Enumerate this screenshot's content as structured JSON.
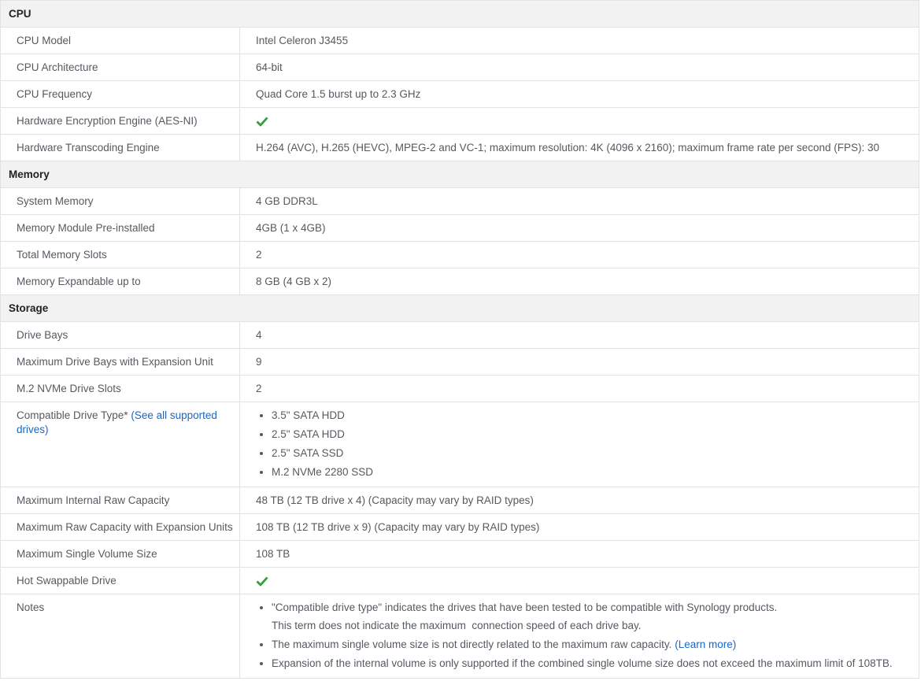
{
  "sections": {
    "cpu": {
      "title": "CPU",
      "rows": [
        {
          "label": "CPU Model",
          "value": "Intel Celeron J3455"
        },
        {
          "label": "CPU Architecture",
          "value": "64-bit"
        },
        {
          "label": "CPU Frequency",
          "value": "Quad Core 1.5 burst up to 2.3 GHz"
        },
        {
          "label": "Hardware Encryption Engine (AES-NI)",
          "icon": "check-icon"
        },
        {
          "label": "Hardware Transcoding Engine",
          "value": "H.264 (AVC), H.265 (HEVC), MPEG-2 and VC-1; maximum resolution: 4K (4096 x 2160); maximum frame rate per second (FPS): 30"
        }
      ]
    },
    "memory": {
      "title": "Memory",
      "rows": [
        {
          "label": "System Memory",
          "value": "4 GB DDR3L"
        },
        {
          "label": "Memory Module Pre-installed",
          "value": "4GB (1 x 4GB)"
        },
        {
          "label": "Total Memory Slots",
          "value": "2"
        },
        {
          "label": "Memory Expandable up to",
          "value": "8 GB (4 GB x 2)"
        }
      ]
    },
    "storage": {
      "title": "Storage",
      "rows": [
        {
          "label": "Drive Bays",
          "value": "4"
        },
        {
          "label": "Maximum Drive Bays with Expansion Unit",
          "value": "9"
        },
        {
          "label": "M.2 NVMe Drive Slots",
          "value": "2"
        },
        {
          "label": "Compatible Drive Type*",
          "link": "(See all supported drives)",
          "items": [
            "3.5\" SATA HDD",
            "2.5\" SATA HDD",
            "2.5\" SATA SSD",
            "M.2 NVMe 2280 SSD"
          ]
        },
        {
          "label": "Maximum Internal Raw Capacity",
          "value": "48 TB (12 TB drive x 4) (Capacity may vary by RAID types)"
        },
        {
          "label": "Maximum Raw Capacity with Expansion Units",
          "value": "108 TB (12 TB drive x 9) (Capacity may vary by RAID types)"
        },
        {
          "label": "Maximum Single Volume Size",
          "value": "108 TB"
        },
        {
          "label": "Hot Swappable Drive",
          "icon": "check-icon"
        },
        {
          "label": "Notes",
          "notes": [
            {
              "line1": "\"Compatible drive type\" indicates the drives that have been tested to be compatible with Synology products.",
              "line2": "This term does not indicate the maximum  connection speed of each drive bay."
            },
            {
              "text": "The maximum single volume size is not directly related to the maximum raw capacity.",
              "link": "(Learn more)"
            },
            {
              "text": "Expansion of the internal volume is only supported if the combined single volume size does not exceed the maximum limit of 108TB."
            }
          ]
        }
      ]
    }
  },
  "colors": {
    "check": "#2e9e3e",
    "link": "#1a66c8",
    "section_bg": "#f2f2f2"
  }
}
